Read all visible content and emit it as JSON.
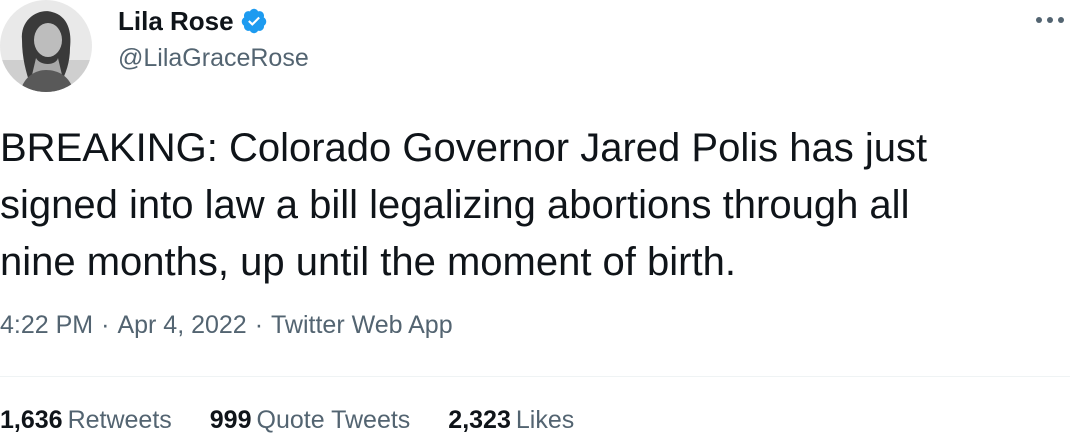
{
  "author": {
    "display_name": "Lila Rose",
    "handle": "@LilaGraceRose",
    "verified": true,
    "avatar_icon": "profile-photo"
  },
  "tweet": {
    "text": "BREAKING: Colorado Governor Jared Polis has just\nsigned into law a bill legalizing abortions through all\nnine months, up until the moment of birth.",
    "time": "4:22 PM",
    "date": "Apr 4, 2022",
    "source": "Twitter Web App",
    "separator": "·"
  },
  "stats": {
    "retweets": {
      "count": "1,636",
      "label": "Retweets"
    },
    "quote_tweets": {
      "count": "999",
      "label": "Quote Tweets"
    },
    "likes": {
      "count": "2,323",
      "label": "Likes"
    }
  },
  "colors": {
    "verified_blue": "#1d9bf0",
    "secondary_text": "#536471",
    "primary_text": "#0f1419"
  },
  "icons": {
    "verified": "verified-badge-icon",
    "more": "more-options-icon"
  }
}
